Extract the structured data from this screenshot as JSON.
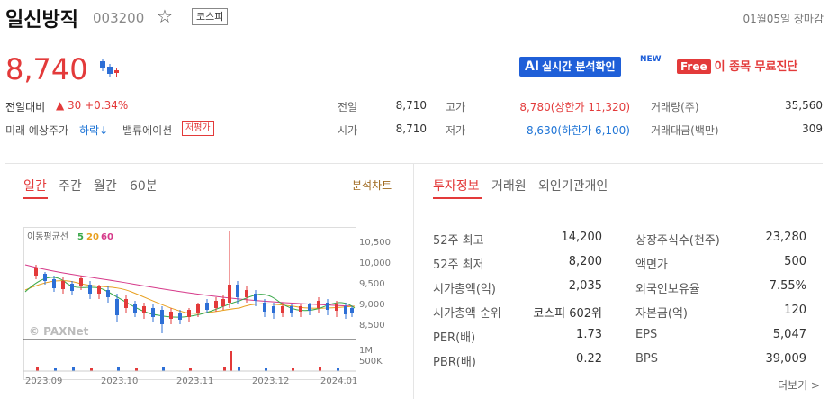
{
  "header": {
    "name": "일신방직",
    "code": "003200",
    "market": "코스피",
    "status": "01월05일 장마감"
  },
  "price": {
    "current": "8,740",
    "change_label": "전일대비",
    "change_value": "▲ 30  +0.34%",
    "forecast_label": "미래 예상주가",
    "forecast_value": "하락↓",
    "valuation_label": "밸류에이션",
    "valuation_badge": "저평가"
  },
  "actions": {
    "ai_icon": "AI",
    "ai_label": "실시간 분석확인",
    "new_tag": "NEW",
    "free_icon": "Free",
    "free_label": "이 종목 무료진단"
  },
  "quote": [
    {
      "label": "전일",
      "value": "8,710",
      "color": "normal"
    },
    {
      "label": "시가",
      "value": "8,710",
      "color": "normal"
    },
    {
      "label": "고가",
      "value": "8,780(상한가 11,320)",
      "color": "red"
    },
    {
      "label": "저가",
      "value": "8,630(하한가 6,100)",
      "color": "blue"
    },
    {
      "label": "거래량(주)",
      "value": "35,560",
      "color": "normal"
    },
    {
      "label": "거래대금(백만)",
      "value": "309",
      "color": "normal"
    }
  ],
  "chart_tabs": [
    "일간",
    "주간",
    "월간",
    "60분"
  ],
  "analysis_link": "분석차트",
  "info_tabs": [
    "투자정보",
    "거래원",
    "외인기관개인"
  ],
  "chart": {
    "ma_label": "이동평균선",
    "ma_5": "5",
    "ma_20": "20",
    "ma_60": "60",
    "watermark": "© PAXNet",
    "y_ticks": [
      "10,500",
      "10,000",
      "9,500",
      "9,000",
      "8,500"
    ],
    "vol_ticks": [
      "1M",
      "500K"
    ],
    "x_ticks": [
      "2023.09",
      "2023.10",
      "2023.11",
      "2023.12",
      "2024.01"
    ],
    "colors": {
      "up": "#e33a3a",
      "down": "#2d6fd6",
      "ma5": "#3aa84a",
      "ma20": "#e8a020",
      "ma60": "#d63a8a"
    }
  },
  "investment": {
    "left": [
      {
        "label": "52주 최고",
        "value": "14,200"
      },
      {
        "label": "52주 최저",
        "value": "8,200"
      },
      {
        "label": "시가총액(억)",
        "value": "2,035"
      },
      {
        "label": "시가총액 순위",
        "value": "코스피 602위"
      },
      {
        "label": "PER(배)",
        "value": "1.73"
      },
      {
        "label": "PBR(배)",
        "value": "0.22"
      }
    ],
    "right": [
      {
        "label": "상장주식수(천주)",
        "value": "23,280"
      },
      {
        "label": "액면가",
        "value": "500"
      },
      {
        "label": "외국인보유율",
        "value": "7.55%"
      },
      {
        "label": "자본금(억)",
        "value": "120"
      },
      {
        "label": "EPS",
        "value": "5,047"
      },
      {
        "label": "BPS",
        "value": "39,009"
      }
    ],
    "more": "더보기 >"
  }
}
